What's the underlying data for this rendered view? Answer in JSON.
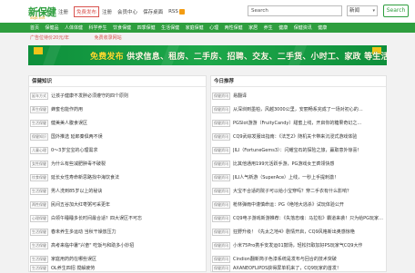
{
  "logo": {
    "text": "新保健",
    "sub": "xbjb.net"
  },
  "topnav": {
    "items": [
      "注册",
      "免费发布",
      "注册",
      "会员中心",
      "保存桌面"
    ],
    "rss": "RSS"
  },
  "search": {
    "value": "Search",
    "placeholder": "Search",
    "type_selected": "新闻",
    "button": "Search"
  },
  "mainnav": [
    "首页",
    "保健品",
    "人体体健",
    "科学养生",
    "饮食保健",
    "四季保健",
    "生活保健",
    "家庭保健",
    "心理",
    "两性保健",
    "家居",
    "养生",
    "健康",
    "保健资讯",
    "健康"
  ],
  "adline": [
    "广告位待价20元/年",
    "免费收录网站"
  ],
  "banner": {
    "text_a": "免费发布",
    "text_b": " 供求信息、租房、二手房、招聘、交友、二手货、小时工、家政 等生活分类信息"
  },
  "left": {
    "title": "保健知识",
    "rows": [
      {
        "tag": "延年方式",
        "text": "让孩子健康不发胖必须遵守的四个原则"
      },
      {
        "tag": "养生保健",
        "text": "蜂蜜也能作药用"
      },
      {
        "tag": "生活保健",
        "text": "健美美人腹食误区"
      },
      {
        "tag": "保健知识",
        "text": "国外推选 延郎秦俱两不误"
      },
      {
        "tag": "儿童心理",
        "text": "0～3岁宝宝的心理需求"
      },
      {
        "tag": "女性保健",
        "text": "为什么有些减肥肿毒不破裂"
      },
      {
        "tag": "饮食保健",
        "text": "延长女性寿命新思路找中海饮食法"
      },
      {
        "tag": "生活保健",
        "text": "男人洗到85岁以上的秘诀"
      },
      {
        "tag": "两性保健",
        "text": "民间五谷加大红枣粥可采更年"
      },
      {
        "tag": "心理保健",
        "text": "白领午睡睡多长时间最合适？四大误区不可忘"
      },
      {
        "tag": "生活保健",
        "text": "春未养生多运动 当秋干燥放压力"
      },
      {
        "tag": "生活保健",
        "text": "高考来临中暑\"兴奋\" 吃饭与和助多小妙招"
      },
      {
        "tag": "生活保健",
        "text": "家庭用药药在哪些误区"
      },
      {
        "tag": "生活保健",
        "text": "OL养生四招 搅解疲劳"
      }
    ]
  },
  "right": {
    "title": "今日推荐",
    "rows": [
      {
        "tag": "保健资讯",
        "text": "易翻译"
      },
      {
        "tag": "保健资讯",
        "text": "从深圳到墨柏，风越3000公里，安丽畅系完成了一场对初心的…"
      },
      {
        "tag": "保健资讯",
        "text": "PGSlot游游（FruityCandy）甜蜜上线，开启你的糖果奇幻之…"
      },
      {
        "tag": "保健资讯",
        "text": "CQ9武综发服出指南：《法芝2》随机关卡带来沉浸式游戏体验"
      },
      {
        "tag": "保健资讯",
        "text": "JILI（FortuneGems3）：闪耀宝石的探险之旅，赢取意外惊喜！"
      },
      {
        "tag": "保健资讯",
        "text": "比其他通用199元活跃手游，PG游戏女王疯领快感"
      },
      {
        "tag": "保健资讯",
        "text": "JILI人气新游（SuperAce）上线，一秒上手提刺激！"
      },
      {
        "tag": "保健资讯",
        "text": "大宝不合适的院子可以给小宝穿吗？穿二手衣有什么影响？"
      },
      {
        "tag": "保健资讯",
        "text": "枪林弹雨中谨慎命运：PG《绝地大逃杀》试玩体验公开"
      },
      {
        "tag": "保健资讯",
        "text": "CQ9电子游戏新游推荐：《失落忠魂：马拉松》霸道来袭！只为给PG玩家…"
      },
      {
        "tag": "保健资讯",
        "text": "狂野升级！《先太之地4》剧情开启，CQ9风格新出奥感惊艳"
      },
      {
        "tag": "保健资讯",
        "text": "小米75Pro携手安发运01鼓场，轻松扫取加好PS玩家气CQ9大作"
      },
      {
        "tag": "保健资讯",
        "text": "Cindion翻新简子色漆系统是发布与回合的技术突破"
      },
      {
        "tag": "保健资讯",
        "text": "AXANEOFLIPDS获得屏单机来了，CQ9玩家的首发！"
      }
    ]
  }
}
